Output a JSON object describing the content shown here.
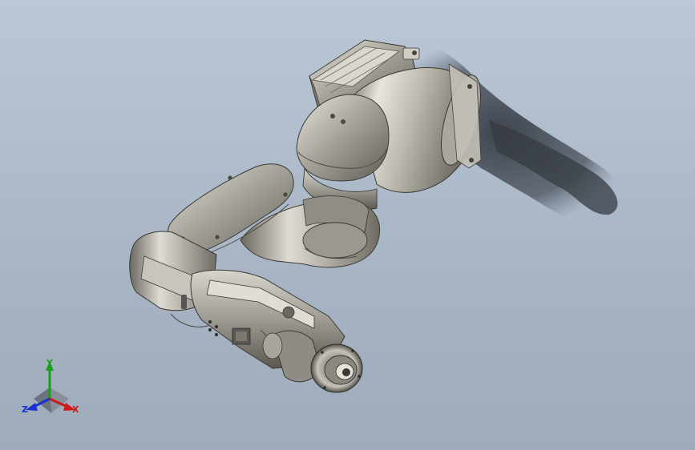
{
  "viewport": {
    "background_top": "#b9c7d6",
    "background_bottom": "#9eabbb",
    "model_description_icon": "robot-arm-model"
  },
  "triad": {
    "x_label": "X",
    "y_label": "Y",
    "z_label": "Z",
    "x_color": "#d01818",
    "y_color": "#18a018",
    "z_color": "#1830d0"
  }
}
